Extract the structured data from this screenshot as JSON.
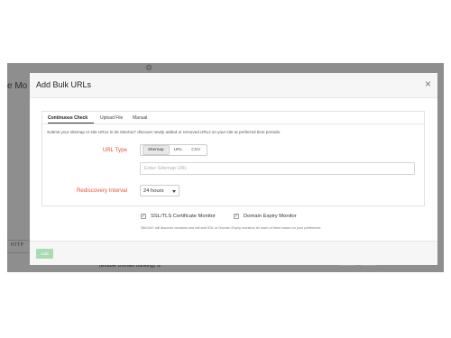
{
  "background": {
    "page_title_fragment": "e Mo",
    "settings_icon": "gear-icon",
    "http_label": "HTTP",
    "bottom_text": "(Enable Domain Blinking) ①"
  },
  "modal": {
    "title": "Add Bulk URLs",
    "close_icon": "close-icon",
    "close_glyph": "×",
    "tabs": [
      {
        "label": "Continuous Check",
        "active": true
      },
      {
        "label": "Upload File",
        "active": false
      },
      {
        "label": "Manual",
        "active": false
      }
    ],
    "description": "Submit your sitemap or site URLs to let Site24x7 discover newly added or removed URLs on your site at preferred time periods.",
    "url_type": {
      "label": "URL Type",
      "options": [
        "Sitemap",
        "URL",
        "CSV"
      ],
      "selected": "Sitemap"
    },
    "sitemap_input": {
      "placeholder": "Enter Sitemap URL",
      "value": ""
    },
    "rediscovery": {
      "label": "Rediscovery Interval",
      "selected": "24 hours"
    },
    "checkboxes": [
      {
        "label": "SSL/TLS Certificate Monitor",
        "checked": true
      },
      {
        "label": "Domain Expiry Monitor",
        "checked": true
      }
    ],
    "check_glyph": "✓",
    "note": "Site24x7 will discover domains and will add SSL or Domain Expiry monitors for each of them based on your preference.",
    "footer": {
      "add_label": "Add"
    }
  },
  "colors": {
    "required_label": "#e5533d",
    "add_button": "#a9dcb1",
    "backdrop": "#8e8e8e"
  }
}
